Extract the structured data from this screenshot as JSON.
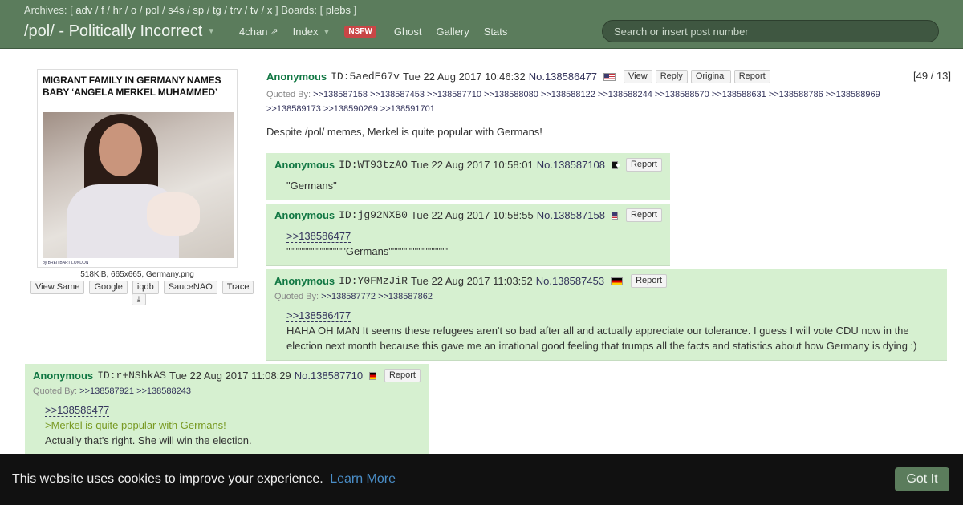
{
  "header": {
    "archives_label": "Archives:",
    "archives": [
      "adv",
      "f",
      "hr",
      "o",
      "pol",
      "s4s",
      "sp",
      "tg",
      "trv",
      "tv",
      "x"
    ],
    "boards_label": "Boards:",
    "boards": [
      "plebs"
    ],
    "board_title": "/pol/ - Politically Incorrect",
    "nav": {
      "fourchan": "4chan",
      "index": "Index",
      "nsfw": "NSFW",
      "ghost": "Ghost",
      "gallery": "Gallery",
      "stats": "Stats"
    },
    "search_placeholder": "Search or insert post number"
  },
  "op": {
    "image": {
      "headline": "MIGRANT FAMILY IN GERMANY NAMES BABY ‘ANGELA MERKEL MUHAMMED’",
      "credit": "by BREITBART LONDON",
      "file_info": "518KiB, 665x665, Germany.png"
    },
    "image_buttons": [
      "View Same",
      "Google",
      "iqdb",
      "SauceNAO",
      "Trace"
    ],
    "name": "Anonymous",
    "id": "ID:5aedE67v",
    "date": "Tue 22 Aug 2017 10:46:32",
    "number": "No.138586477",
    "flag": "us",
    "buttons": [
      "View",
      "Reply",
      "Original",
      "Report"
    ],
    "counter": "[49 / 13]",
    "quoted_by_label": "Quoted By:",
    "quoted_by_line1": ">>138587158 >>138587453 >>138587710 >>138588080 >>138588122 >>138588244 >>138588570 >>138588631 >>138588786 >>138588969",
    "quoted_by_line2": ">>138589173 >>138590269 >>138591701",
    "message": "Despite /pol/ memes, Merkel is quite popular with Germans!"
  },
  "replies": [
    {
      "name": "Anonymous",
      "id": "ID:WT93tzAO",
      "date": "Tue 22 Aug 2017 10:58:01",
      "number": "No.138587108",
      "flag": "pirate",
      "report": "Report",
      "lines": [
        "\"Germans\""
      ]
    },
    {
      "name": "Anonymous",
      "id": "ID:jg92NXB0",
      "date": "Tue 22 Aug 2017 10:58:55",
      "number": "No.138587158",
      "flag": "us",
      "report": "Report",
      "quote": ">>138586477",
      "lines": [
        "\"\"\"\"\"\"\"\"\"\"\"\"\"\"\"\"Germans\"\"\"\"\"\"\"\"\"\"\"\"\"\"\"\""
      ]
    },
    {
      "name": "Anonymous",
      "id": "ID:Y0FMzJiR",
      "date": "Tue 22 Aug 2017 11:03:52",
      "number": "No.138587453",
      "flag": "de",
      "report": "Report",
      "quoted_by_label": "Quoted By:",
      "quoted_by": ">>138587772 >>138587862",
      "quote": ">>138586477",
      "lines": [
        "HAHA OH MAN It seems these refugees aren't so bad after all and actually appreciate our tolerance. I guess I will vote CDU now in the",
        "election next month because this gave me an irrational good feeling that trumps all the facts and statistics about how Germany is dying :)"
      ]
    },
    {
      "name": "Anonymous",
      "id": "ID:r+NShkAS",
      "date": "Tue 22 Aug 2017 11:08:29",
      "number": "No.138587710",
      "flag": "de",
      "report": "Report",
      "quoted_by_label": "Quoted By:",
      "quoted_by": ">>138587921 >>138588243",
      "quote": ">>138586477",
      "greentext": ">Merkel is quite popular with Germans!",
      "lines": [
        "Actually that's right. She will win the election."
      ]
    }
  ],
  "cookie": {
    "text": "This website uses cookies to improve your experience.",
    "link": "Learn More",
    "button": "Got It"
  }
}
